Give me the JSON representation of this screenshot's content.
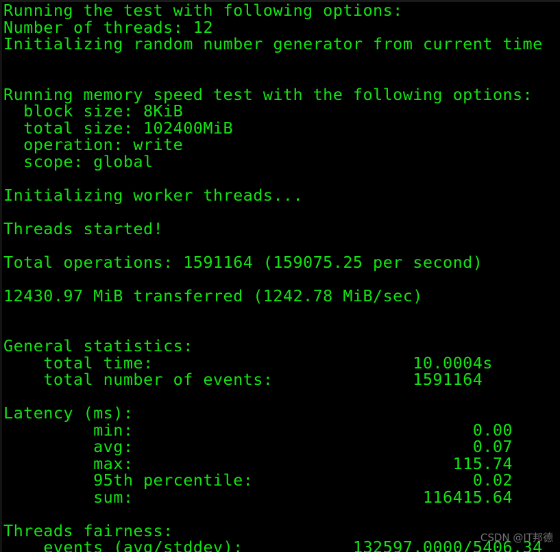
{
  "terminal": {
    "background_color": "#000000",
    "text_color": "#13e313",
    "watermark_color": "#b9b9b9",
    "watermark": "CSDN @IT邦德",
    "output": "Running the test with following options:\nNumber of threads: 12\nInitializing random number generator from current time\n\n\nRunning memory speed test with the following options:\n  block size: 8KiB\n  total size: 102400MiB\n  operation: write\n  scope: global\n\nInitializing worker threads...\n\nThreads started!\n\nTotal operations: 1591164 (159075.25 per second)\n\n12430.97 MiB transferred (1242.78 MiB/sec)\n\n\nGeneral statistics:\n    total time:                          10.0004s\n    total number of events:              1591164\n\nLatency (ms):\n         min:                                  0.00\n         avg:                                  0.07\n         max:                                115.74\n         95th percentile:                      0.02\n         sum:                             116415.64\n\nThreads fairness:\n    events (avg/stddev):           132597.0000/5406.34",
    "lines": {
      "header_running_test": "Running the test with following options:",
      "threads": "Number of threads: 12",
      "init_rng": "Initializing random number generator from current time",
      "header_memory_test": "Running memory speed test with the following options:",
      "block_size": "  block size: 8KiB",
      "total_size": "  total size: 102400MiB",
      "operation": "  operation: write",
      "scope": "  scope: global",
      "init_workers": "Initializing worker threads...",
      "threads_started": "Threads started!",
      "total_operations": "Total operations: 1591164 (159075.25 per second)",
      "transferred": "12430.97 MiB transferred (1242.78 MiB/sec)",
      "general_statistics_header": "General statistics:",
      "total_time": "    total time:                          10.0004s",
      "total_events": "    total number of events:              1591164",
      "latency_header": "Latency (ms):",
      "latency_min": "         min:                                  0.00",
      "latency_avg": "         avg:                                  0.07",
      "latency_max": "         max:                                115.74",
      "latency_p95": "         95th percentile:                      0.02",
      "latency_sum": "         sum:                             116415.64",
      "fairness_header": "Threads fairness:",
      "fairness_events": "    events (avg/stddev):           132597.0000/5406.34"
    },
    "values": {
      "number_of_threads": "12",
      "block_size": "8KiB",
      "total_size": "102400MiB",
      "operation": "write",
      "scope": "global",
      "total_operations": "1591164",
      "operations_per_second": "159075.25",
      "mib_transferred": "12430.97",
      "mib_per_sec": "1242.78",
      "total_time": "10.0004s",
      "total_number_of_events": "1591164",
      "latency_min": "0.00",
      "latency_avg": "0.07",
      "latency_max": "115.74",
      "latency_95th_percentile": "0.02",
      "latency_sum": "116415.64",
      "events_avg": "132597.0000",
      "events_stddev": "5406.34"
    }
  }
}
